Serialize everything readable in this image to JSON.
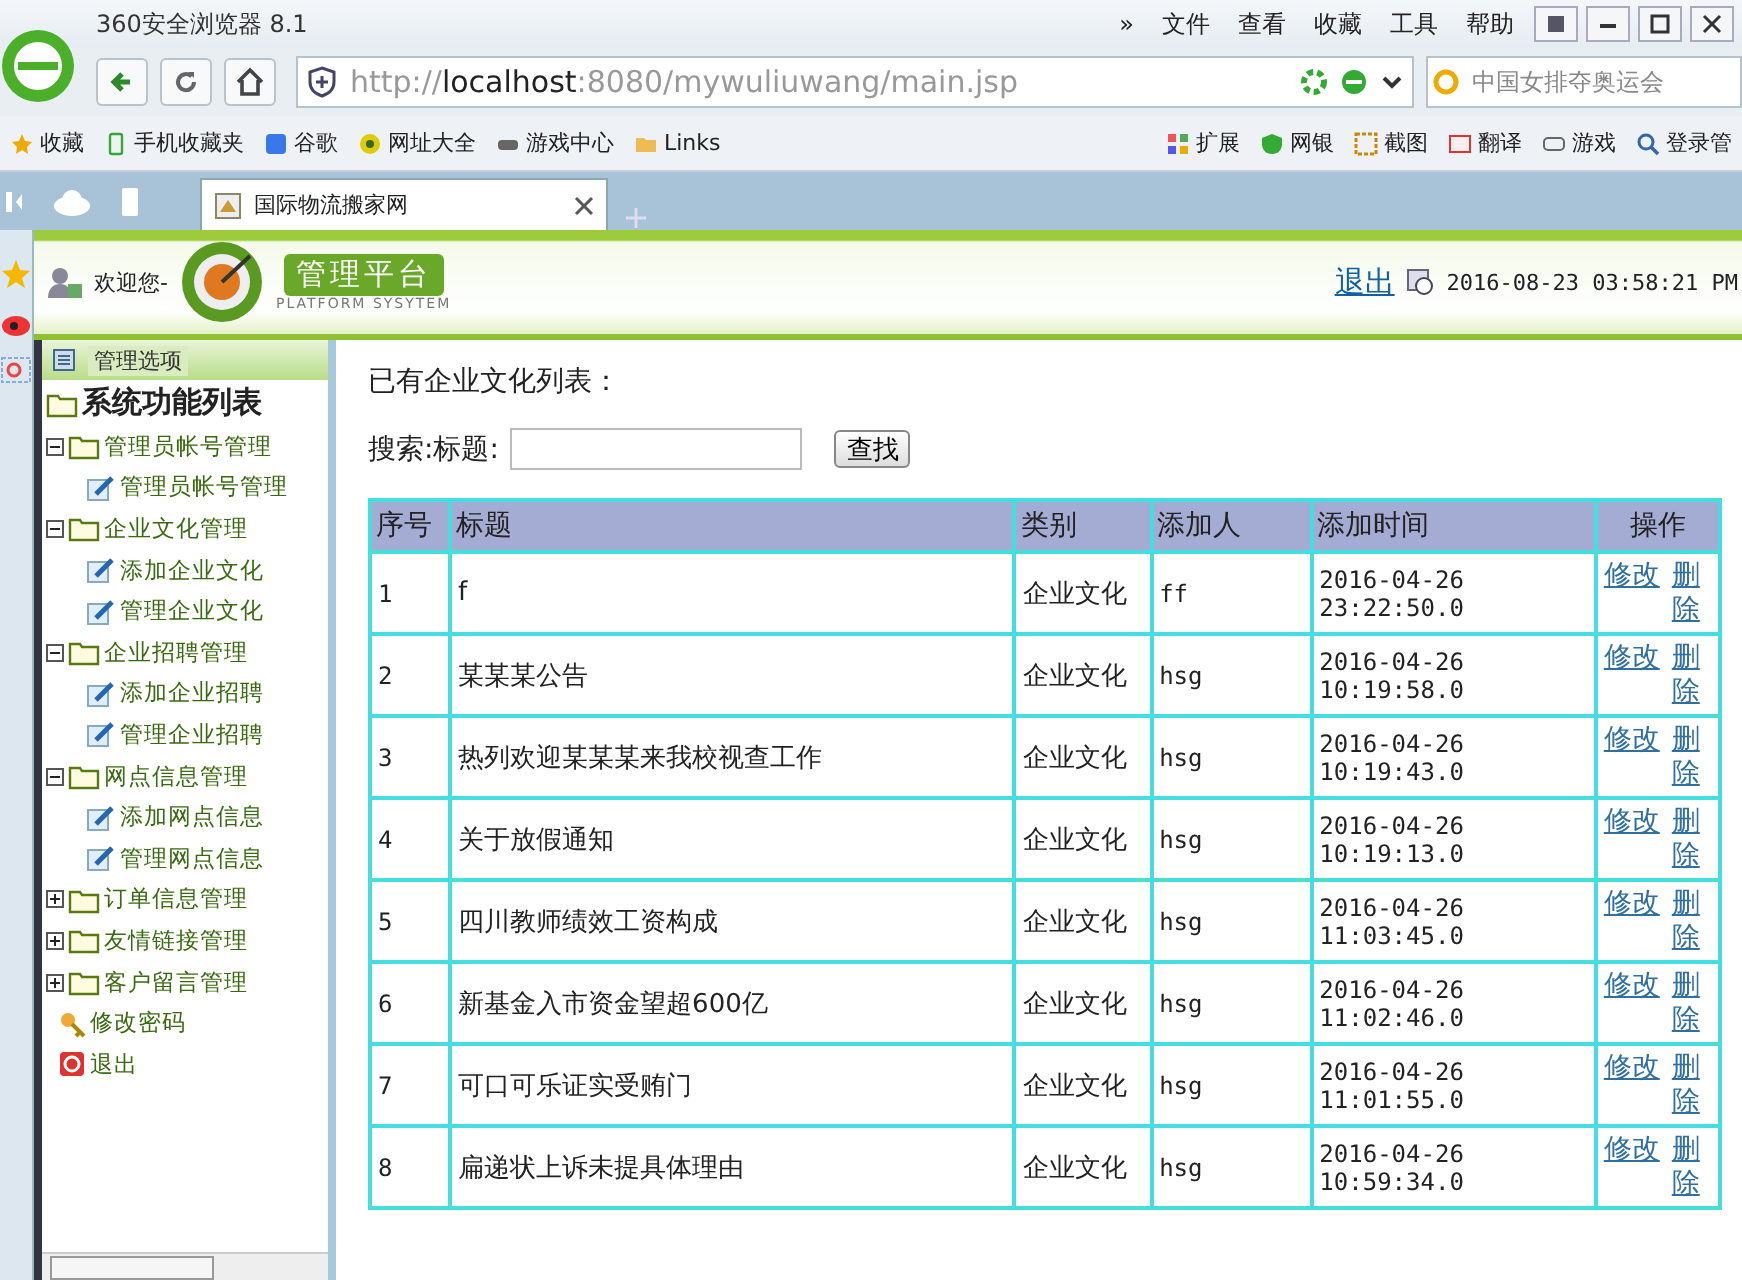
{
  "browser": {
    "title": "360安全浏览器 8.1",
    "more": "»",
    "menu": [
      "文件",
      "查看",
      "收藏",
      "工具",
      "帮助"
    ],
    "url": "http://**localhost**:8080/mywuliuwang/main.jsp",
    "search_placeholder": "中国女排夺奥运会",
    "bookmarks": [
      "收藏",
      "手机收藏夹",
      "谷歌",
      "网址大全",
      "游戏中心",
      "Links"
    ],
    "extensions": [
      "扩展",
      "网银",
      "截图",
      "翻译",
      "游戏",
      "登录管"
    ],
    "tabs": [
      {
        "label": "国际物流搬家网",
        "selected": true
      }
    ]
  },
  "header": {
    "greeting": "欢迎您-",
    "logo_title": "管理平台",
    "logo_subtitle": "PLATFORM SYSYTEM",
    "logout": "退出",
    "datetime": "2016-08-23 03:58:21 PM"
  },
  "sidebar": {
    "heading": "管理选项",
    "tree_title": "系统功能列表",
    "items": [
      {
        "label": "管理员帐号管理",
        "kind": "folder",
        "expanded": true,
        "children": [
          {
            "label": "管理员帐号管理",
            "kind": "page"
          }
        ]
      },
      {
        "label": "企业文化管理",
        "kind": "folder",
        "expanded": true,
        "children": [
          {
            "label": "添加企业文化",
            "kind": "page"
          },
          {
            "label": "管理企业文化",
            "kind": "page"
          }
        ]
      },
      {
        "label": "企业招聘管理",
        "kind": "folder",
        "expanded": true,
        "children": [
          {
            "label": "添加企业招聘",
            "kind": "page"
          },
          {
            "label": "管理企业招聘",
            "kind": "page"
          }
        ]
      },
      {
        "label": "网点信息管理",
        "kind": "folder",
        "expanded": true,
        "children": [
          {
            "label": "添加网点信息",
            "kind": "page"
          },
          {
            "label": "管理网点信息",
            "kind": "page"
          }
        ]
      },
      {
        "label": "订单信息管理",
        "kind": "folder",
        "expanded": false
      },
      {
        "label": "友情链接管理",
        "kind": "folder",
        "expanded": false
      },
      {
        "label": "客户留言管理",
        "kind": "folder",
        "expanded": false
      },
      {
        "label": "修改密码",
        "kind": "key"
      },
      {
        "label": "退出",
        "kind": "exit"
      }
    ]
  },
  "content": {
    "caption": "已有企业文化列表：",
    "search": {
      "label": "搜索:标题:",
      "button": "查找"
    },
    "table": {
      "columns": [
        "序号",
        "标题",
        "类别",
        "添加人",
        "添加时间",
        "操作"
      ],
      "rows": [
        {
          "cells": [
            "1",
            "f",
            "企业文化",
            "ff",
            "2016-04-26 23:22:50.0"
          ],
          "actions": [
            "修改",
            "删除"
          ]
        },
        {
          "cells": [
            "2",
            "某某某公告",
            "企业文化",
            "hsg",
            "2016-04-26 10:19:58.0"
          ],
          "actions": [
            "修改",
            "删除"
          ]
        },
        {
          "cells": [
            "3",
            "热列欢迎某某某来我校视查工作",
            "企业文化",
            "hsg",
            "2016-04-26 10:19:43.0"
          ],
          "actions": [
            "修改",
            "删除"
          ]
        },
        {
          "cells": [
            "4",
            "关于放假通知",
            "企业文化",
            "hsg",
            "2016-04-26 10:19:13.0"
          ],
          "actions": [
            "修改",
            "删除"
          ]
        },
        {
          "cells": [
            "5",
            "四川教师绩效工资构成",
            "企业文化",
            "hsg",
            "2016-04-26 11:03:45.0"
          ],
          "actions": [
            "修改",
            "删除"
          ]
        },
        {
          "cells": [
            "6",
            "新基金入市资金望超600亿",
            "企业文化",
            "hsg",
            "2016-04-26 11:02:46.0"
          ],
          "actions": [
            "修改",
            "删除"
          ]
        },
        {
          "cells": [
            "7",
            "可口可乐证实受贿门",
            "企业文化",
            "hsg",
            "2016-04-26 11:01:55.0"
          ],
          "actions": [
            "修改",
            "删除"
          ]
        },
        {
          "cells": [
            "8",
            "扁递状上诉未提具体理由",
            "企业文化",
            "hsg",
            "2016-04-26 10:59:34.0"
          ],
          "actions": [
            "修改",
            "删除"
          ]
        }
      ]
    }
  }
}
